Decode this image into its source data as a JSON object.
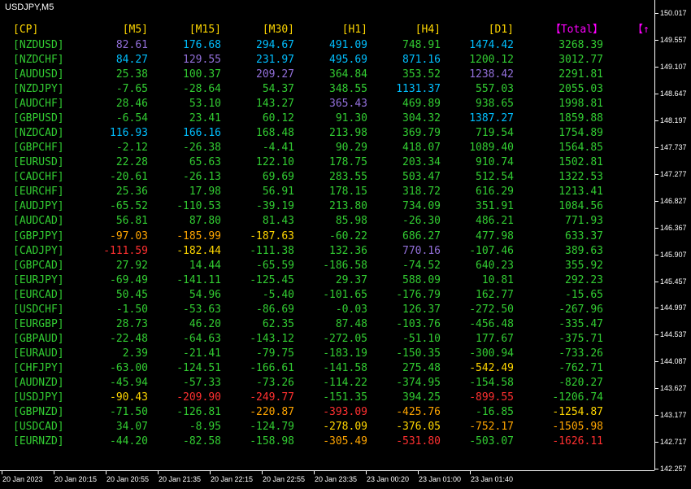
{
  "window": {
    "title": "USDJPY,M5"
  },
  "colors": {
    "header_gold": "#FFD700",
    "total_magenta": "#FF00FF",
    "pair_green": "#32CD32"
  },
  "table": {
    "headers": [
      "[CP]",
      "[M5]",
      "[M15]",
      "[M30]",
      "[H1]",
      "[H4]",
      "[D1]",
      "【Total】"
    ],
    "arrow_header": "【↑",
    "rows": [
      {
        "pair": "[NZDUSD]",
        "values": [
          "82.61",
          "176.68",
          "294.67",
          "491.09",
          "748.91",
          "1474.42",
          "3268.39"
        ],
        "colors": [
          "#9370DB",
          "#00BFFF",
          "#00BFFF",
          "#00BFFF",
          "#32CD32",
          "#00BFFF",
          "#32CD32"
        ]
      },
      {
        "pair": "[NZDCHF]",
        "values": [
          "84.27",
          "129.55",
          "231.97",
          "495.69",
          "871.16",
          "1200.12",
          "3012.77"
        ],
        "colors": [
          "#00BFFF",
          "#9370DB",
          "#00BFFF",
          "#00BFFF",
          "#00BFFF",
          "#32CD32",
          "#32CD32"
        ]
      },
      {
        "pair": "[AUDUSD]",
        "values": [
          "25.38",
          "100.37",
          "209.27",
          "364.84",
          "353.52",
          "1238.42",
          "2291.81"
        ],
        "colors": [
          "#32CD32",
          "#32CD32",
          "#9370DB",
          "#32CD32",
          "#32CD32",
          "#9370DB",
          "#32CD32"
        ]
      },
      {
        "pair": "[NZDJPY]",
        "values": [
          "-7.65",
          "-28.64",
          "54.37",
          "348.55",
          "1131.37",
          "557.03",
          "2055.03"
        ],
        "colors": [
          "#32CD32",
          "#32CD32",
          "#32CD32",
          "#32CD32",
          "#00BFFF",
          "#32CD32",
          "#32CD32"
        ]
      },
      {
        "pair": "[AUDCHF]",
        "values": [
          "28.46",
          "53.10",
          "143.27",
          "365.43",
          "469.89",
          "938.65",
          "1998.81"
        ],
        "colors": [
          "#32CD32",
          "#32CD32",
          "#32CD32",
          "#9370DB",
          "#32CD32",
          "#32CD32",
          "#32CD32"
        ]
      },
      {
        "pair": "[GBPUSD]",
        "values": [
          "-6.54",
          "23.41",
          "60.12",
          "91.30",
          "304.32",
          "1387.27",
          "1859.88"
        ],
        "colors": [
          "#32CD32",
          "#32CD32",
          "#32CD32",
          "#32CD32",
          "#32CD32",
          "#00BFFF",
          "#32CD32"
        ]
      },
      {
        "pair": "[NZDCAD]",
        "values": [
          "116.93",
          "166.16",
          "168.48",
          "213.98",
          "369.79",
          "719.54",
          "1754.89"
        ],
        "colors": [
          "#00BFFF",
          "#00BFFF",
          "#32CD32",
          "#32CD32",
          "#32CD32",
          "#32CD32",
          "#32CD32"
        ]
      },
      {
        "pair": "[GBPCHF]",
        "values": [
          "-2.12",
          "-26.38",
          "-4.41",
          "90.29",
          "418.07",
          "1089.40",
          "1564.85"
        ],
        "colors": [
          "#32CD32",
          "#32CD32",
          "#32CD32",
          "#32CD32",
          "#32CD32",
          "#32CD32",
          "#32CD32"
        ]
      },
      {
        "pair": "[EURUSD]",
        "values": [
          "22.28",
          "65.63",
          "122.10",
          "178.75",
          "203.34",
          "910.74",
          "1502.81"
        ],
        "colors": [
          "#32CD32",
          "#32CD32",
          "#32CD32",
          "#32CD32",
          "#32CD32",
          "#32CD32",
          "#32CD32"
        ]
      },
      {
        "pair": "[CADCHF]",
        "values": [
          "-20.61",
          "-26.13",
          "69.69",
          "283.55",
          "503.47",
          "512.54",
          "1322.53"
        ],
        "colors": [
          "#32CD32",
          "#32CD32",
          "#32CD32",
          "#32CD32",
          "#32CD32",
          "#32CD32",
          "#32CD32"
        ]
      },
      {
        "pair": "[EURCHF]",
        "values": [
          "25.36",
          "17.98",
          "56.91",
          "178.15",
          "318.72",
          "616.29",
          "1213.41"
        ],
        "colors": [
          "#32CD32",
          "#32CD32",
          "#32CD32",
          "#32CD32",
          "#32CD32",
          "#32CD32",
          "#32CD32"
        ]
      },
      {
        "pair": "[AUDJPY]",
        "values": [
          "-65.52",
          "-110.53",
          "-39.19",
          "213.80",
          "734.09",
          "351.91",
          "1084.56"
        ],
        "colors": [
          "#32CD32",
          "#32CD32",
          "#32CD32",
          "#32CD32",
          "#32CD32",
          "#32CD32",
          "#32CD32"
        ]
      },
      {
        "pair": "[AUDCAD]",
        "values": [
          "56.81",
          "87.80",
          "81.43",
          "85.98",
          "-26.30",
          "486.21",
          "771.93"
        ],
        "colors": [
          "#32CD32",
          "#32CD32",
          "#32CD32",
          "#32CD32",
          "#32CD32",
          "#32CD32",
          "#32CD32"
        ]
      },
      {
        "pair": "[GBPJPY]",
        "values": [
          "-97.03",
          "-185.99",
          "-187.63",
          "-60.22",
          "686.27",
          "477.98",
          "633.37"
        ],
        "colors": [
          "#FFA500",
          "#FFA500",
          "#FFD700",
          "#32CD32",
          "#32CD32",
          "#32CD32",
          "#32CD32"
        ]
      },
      {
        "pair": "[CADJPY]",
        "values": [
          "-111.59",
          "-182.44",
          "-111.38",
          "132.36",
          "770.16",
          "-107.46",
          "389.63"
        ],
        "colors": [
          "#FF3030",
          "#FFD700",
          "#32CD32",
          "#32CD32",
          "#9370DB",
          "#32CD32",
          "#32CD32"
        ]
      },
      {
        "pair": "[GBPCAD]",
        "values": [
          "27.92",
          "14.44",
          "-65.59",
          "-186.58",
          "-74.52",
          "640.23",
          "355.92"
        ],
        "colors": [
          "#32CD32",
          "#32CD32",
          "#32CD32",
          "#32CD32",
          "#32CD32",
          "#32CD32",
          "#32CD32"
        ]
      },
      {
        "pair": "[EURJPY]",
        "values": [
          "-69.49",
          "-141.11",
          "-125.45",
          "29.37",
          "588.09",
          "10.81",
          "292.23"
        ],
        "colors": [
          "#32CD32",
          "#32CD32",
          "#32CD32",
          "#32CD32",
          "#32CD32",
          "#32CD32",
          "#32CD32"
        ]
      },
      {
        "pair": "[EURCAD]",
        "values": [
          "50.45",
          "54.96",
          "-5.40",
          "-101.65",
          "-176.79",
          "162.77",
          "-15.65"
        ],
        "colors": [
          "#32CD32",
          "#32CD32",
          "#32CD32",
          "#32CD32",
          "#32CD32",
          "#32CD32",
          "#32CD32"
        ]
      },
      {
        "pair": "[USDCHF]",
        "values": [
          "-1.50",
          "-53.63",
          "-86.69",
          "-0.03",
          "126.37",
          "-272.50",
          "-267.96"
        ],
        "colors": [
          "#32CD32",
          "#32CD32",
          "#32CD32",
          "#32CD32",
          "#32CD32",
          "#32CD32",
          "#32CD32"
        ]
      },
      {
        "pair": "[EURGBP]",
        "values": [
          "28.73",
          "46.20",
          "62.35",
          "87.48",
          "-103.76",
          "-456.48",
          "-335.47"
        ],
        "colors": [
          "#32CD32",
          "#32CD32",
          "#32CD32",
          "#32CD32",
          "#32CD32",
          "#32CD32",
          "#32CD32"
        ]
      },
      {
        "pair": "[GBPAUD]",
        "values": [
          "-22.48",
          "-64.63",
          "-143.12",
          "-272.05",
          "-51.10",
          "177.67",
          "-375.71"
        ],
        "colors": [
          "#32CD32",
          "#32CD32",
          "#32CD32",
          "#32CD32",
          "#32CD32",
          "#32CD32",
          "#32CD32"
        ]
      },
      {
        "pair": "[EURAUD]",
        "values": [
          "2.39",
          "-21.41",
          "-79.75",
          "-183.19",
          "-150.35",
          "-300.94",
          "-733.26"
        ],
        "colors": [
          "#32CD32",
          "#32CD32",
          "#32CD32",
          "#32CD32",
          "#32CD32",
          "#32CD32",
          "#32CD32"
        ]
      },
      {
        "pair": "[CHFJPY]",
        "values": [
          "-63.00",
          "-124.51",
          "-166.61",
          "-141.58",
          "275.48",
          "-542.49",
          "-762.71"
        ],
        "colors": [
          "#32CD32",
          "#32CD32",
          "#32CD32",
          "#32CD32",
          "#32CD32",
          "#FFD700",
          "#32CD32"
        ]
      },
      {
        "pair": "[AUDNZD]",
        "values": [
          "-45.94",
          "-57.33",
          "-73.26",
          "-114.22",
          "-374.95",
          "-154.58",
          "-820.27"
        ],
        "colors": [
          "#32CD32",
          "#32CD32",
          "#32CD32",
          "#32CD32",
          "#32CD32",
          "#32CD32",
          "#32CD32"
        ]
      },
      {
        "pair": "[USDJPY]",
        "values": [
          "-90.43",
          "-209.90",
          "-249.77",
          "-151.35",
          "394.25",
          "-899.55",
          "-1206.74"
        ],
        "colors": [
          "#FFD700",
          "#FF3030",
          "#FF3030",
          "#32CD32",
          "#32CD32",
          "#FF3030",
          "#32CD32"
        ]
      },
      {
        "pair": "[GBPNZD]",
        "values": [
          "-71.50",
          "-126.81",
          "-220.87",
          "-393.09",
          "-425.76",
          "-16.85",
          "-1254.87"
        ],
        "colors": [
          "#32CD32",
          "#32CD32",
          "#FFA500",
          "#FF3030",
          "#FFA500",
          "#32CD32",
          "#FFD700"
        ]
      },
      {
        "pair": "[USDCAD]",
        "values": [
          "34.07",
          "-8.95",
          "-124.79",
          "-278.09",
          "-376.05",
          "-752.17",
          "-1505.98"
        ],
        "colors": [
          "#32CD32",
          "#32CD32",
          "#32CD32",
          "#FFD700",
          "#FFD700",
          "#FFA500",
          "#FFA500"
        ]
      },
      {
        "pair": "[EURNZD]",
        "values": [
          "-44.20",
          "-82.58",
          "-158.98",
          "-305.49",
          "-531.80",
          "-503.07",
          "-1626.11"
        ],
        "colors": [
          "#32CD32",
          "#32CD32",
          "#32CD32",
          "#FFA500",
          "#FF3030",
          "#32CD32",
          "#FF3030"
        ]
      }
    ]
  },
  "price_axis": {
    "labels": [
      "150.017",
      "149.557",
      "149.107",
      "148.647",
      "148.197",
      "147.737",
      "147.277",
      "146.827",
      "146.367",
      "145.907",
      "145.457",
      "144.997",
      "144.537",
      "144.087",
      "143.627",
      "143.177",
      "142.717",
      "142.257"
    ]
  },
  "time_axis": {
    "labels": [
      "20 Jan 2023",
      "20 Jan 20:15",
      "20 Jan 20:55",
      "20 Jan 21:35",
      "20 Jan 22:15",
      "20 Jan 22:55",
      "20 Jan 23:35",
      "23 Jan 00:20",
      "23 Jan 01:00",
      "23 Jan 01:40"
    ]
  }
}
